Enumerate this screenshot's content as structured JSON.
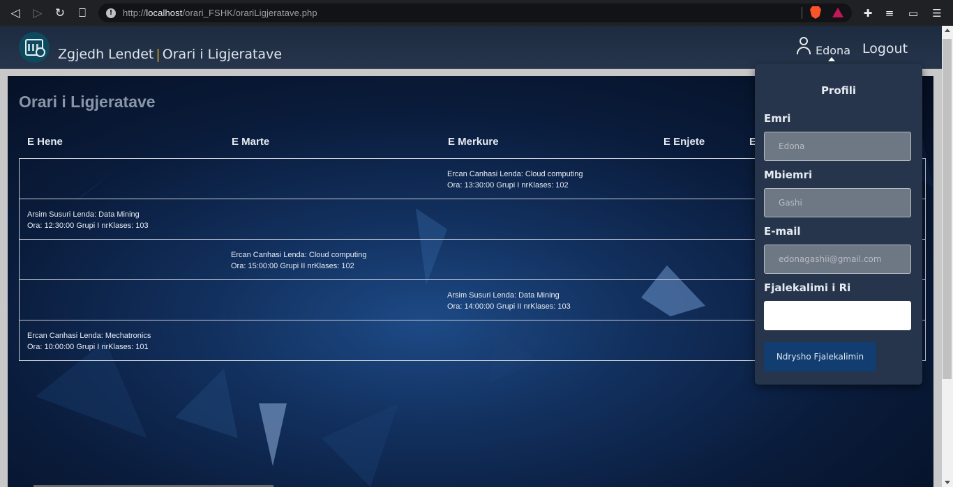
{
  "browser": {
    "url_prefix": "http://",
    "url_host": "localhost",
    "url_path": "/orari_FSHK/orariLigjeratave.php",
    "icons": [
      "back-icon",
      "forward-icon",
      "reload-icon",
      "bookmark-icon",
      "info-icon",
      "brave-shields-icon",
      "brave-rewards-icon",
      "extensions-icon",
      "playlist-icon",
      "wallet-icon",
      "menu-icon"
    ]
  },
  "header": {
    "title_left": "Zgjedh Lendet",
    "separator": "|",
    "title_right": "Orari i Ligjeratave",
    "user_name": "Edona",
    "logout_label": "Logout"
  },
  "main": {
    "heading": "Orari i Ligjeratave",
    "days": [
      "E Hene",
      "E Marte",
      "E Merkure",
      "E Enjete",
      "E"
    ],
    "rows": [
      {
        "col": 2,
        "line1": "Ercan Canhasi Lenda: Cloud computing",
        "line2": "Ora: 13:30:00   Grupi I nrKlases: 102"
      },
      {
        "col": 0,
        "line1": "Arsim Susuri Lenda: Data Mining",
        "line2": "Ora: 12:30:00   Grupi I nrKlases: 103"
      },
      {
        "col": 1,
        "line1": "Ercan Canhasi Lenda: Cloud computing",
        "line2": "Ora: 15:00:00   Grupi II nrKlases: 102"
      },
      {
        "col": 2,
        "line1": "Arsim Susuri Lenda: Data Mining",
        "line2": "Ora: 14:00:00   Grupi II nrKlases: 103"
      },
      {
        "col": 0,
        "line1": "Ercan Canhasi Lenda: Mechatronics",
        "line2": "Ora: 10:00:00   Grupi I nrKlases: 101"
      }
    ]
  },
  "profile": {
    "title": "Profili",
    "first_name_label": "Emri",
    "first_name_value": "Edona",
    "last_name_label": "Mbiemri",
    "last_name_value": "Gashi",
    "email_label": "E-mail",
    "email_value": "edonagashii@gmail.com",
    "new_password_label": "Fjalekalimi i Ri",
    "new_password_value": "",
    "change_password_button": "Ndrysho Fjalekalimin"
  }
}
